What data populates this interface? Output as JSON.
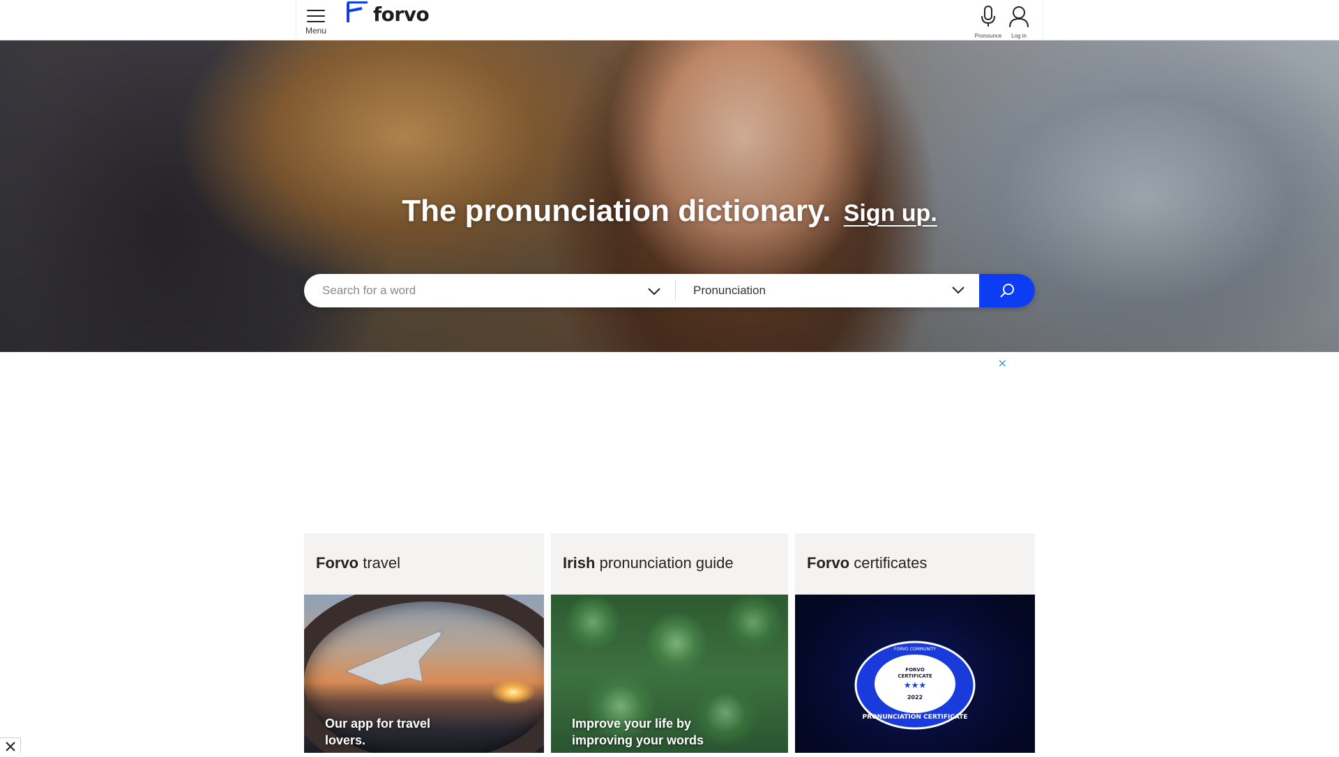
{
  "header": {
    "menu_label": "Menu",
    "logo_text": "forvo",
    "pronounce_label": "Pronounce",
    "login_label": "Log in",
    "brand_color": "#0d3df2"
  },
  "hero": {
    "title": "The pronunciation dictionary.",
    "signup_link": "Sign up.",
    "search": {
      "placeholder": "Search for a word",
      "mode_selected": "Pronunciation"
    }
  },
  "ad": {
    "close_symbol": "✕"
  },
  "cards": [
    {
      "title_bold": "Forvo",
      "title_rest": " travel",
      "caption_line1": "Our app for travel",
      "caption_line2": "lovers."
    },
    {
      "title_bold": "Irish",
      "title_rest": " pronunciation guide",
      "caption_line1": "Improve your life by",
      "caption_line2": "improving your words"
    },
    {
      "title_bold": "Forvo",
      "title_rest": " certificates",
      "badge_top": "FORVO COMMUNITY",
      "badge_mid1": "FORVO",
      "badge_mid2": "CERTIFICATE",
      "badge_stars": "★★★",
      "badge_year": "2022",
      "badge_bottom": "PRONUNCIATION CERTIFICATE"
    }
  ],
  "icons": [
    "hamburger-menu-icon",
    "forvo-logo-icon",
    "microphone-icon",
    "user-icon",
    "chevron-down-icon",
    "search-icon",
    "close-icon"
  ]
}
